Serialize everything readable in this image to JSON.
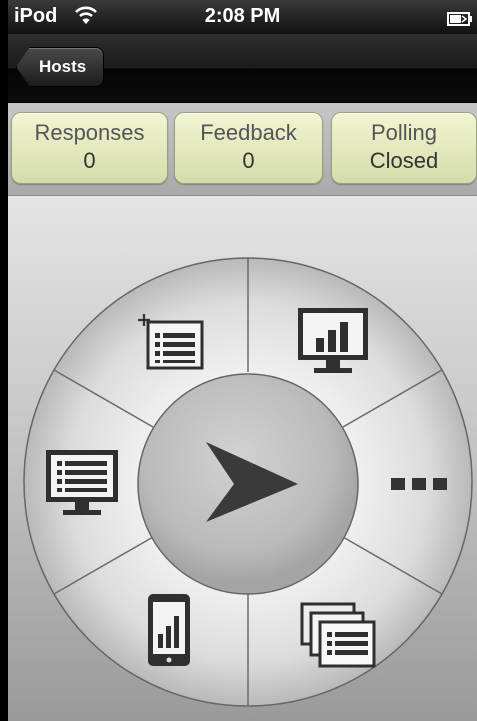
{
  "status_bar": {
    "carrier": "iPod",
    "time": "2:08 PM"
  },
  "nav": {
    "back_label": "Hosts"
  },
  "stats": {
    "responses": {
      "label": "Responses",
      "value": "0"
    },
    "feedback": {
      "label": "Feedback",
      "value": "0"
    },
    "polling": {
      "label": "Polling",
      "value": "Closed"
    }
  },
  "wheel": {
    "center_icon": "play-arrow-icon",
    "segments": [
      {
        "id": "new-question",
        "icon": "add-list-icon"
      },
      {
        "id": "show-results",
        "icon": "monitor-bar-chart-icon"
      },
      {
        "id": "more",
        "icon": "more-dots-icon"
      },
      {
        "id": "question-sets",
        "icon": "stacked-lists-icon"
      },
      {
        "id": "device-results",
        "icon": "phone-bar-chart-icon"
      },
      {
        "id": "show-question",
        "icon": "monitor-list-icon"
      }
    ]
  },
  "colors": {
    "stat_bg": "#e6ebc0",
    "icon_dark": "#2f2f2f"
  }
}
